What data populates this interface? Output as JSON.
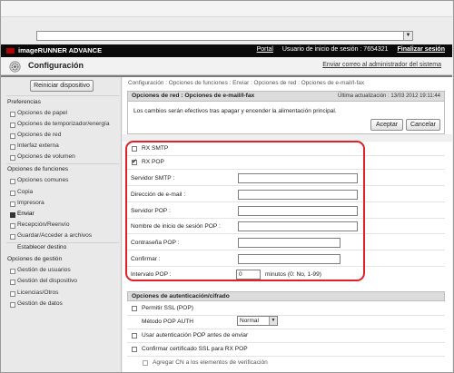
{
  "brand": {
    "product": "imageRUNNER ADVANCE",
    "portal_link": "Portal",
    "user_info": "Usuario de inicio de sesión : 7654321",
    "logout": "Finalizar sesión"
  },
  "header": {
    "title": "Configuración",
    "admin_link": "Enviar correo al administrador del sistema"
  },
  "sidebar": {
    "restart_button": "Reiniciar dispositivo",
    "items": [
      {
        "label": "Preferencias",
        "kind": "head"
      },
      {
        "label": "Opciones de papel",
        "kind": "sub"
      },
      {
        "label": "Opciones de temporizador/energía",
        "kind": "sub"
      },
      {
        "label": "Opciones de red",
        "kind": "sub"
      },
      {
        "label": "Interfaz externa",
        "kind": "sub"
      },
      {
        "label": "Opciones de volumen",
        "kind": "sub"
      },
      {
        "label": "Opciones de funciones",
        "kind": "head"
      },
      {
        "label": "Opciones comunes",
        "kind": "sub"
      },
      {
        "label": "Copia",
        "kind": "sub"
      },
      {
        "label": "Impresora",
        "kind": "sub"
      },
      {
        "label": "Enviar",
        "kind": "sub",
        "active": true
      },
      {
        "label": "Recepción/Reenvío",
        "kind": "sub"
      },
      {
        "label": "Guardar/Acceder a archivos",
        "kind": "sub"
      },
      {
        "label": "Establecer destino",
        "kind": "head"
      },
      {
        "label": "Opciones de gestión",
        "kind": "head"
      },
      {
        "label": "Gestión de usuarios",
        "kind": "sub"
      },
      {
        "label": "Gestión del dispositivo",
        "kind": "sub"
      },
      {
        "label": "Licencias/Otros",
        "kind": "sub"
      },
      {
        "label": "Gestión de datos",
        "kind": "sub"
      }
    ]
  },
  "main": {
    "breadcrumb": "Configuración : Opciones de funciones : Enviar : Opciones de red : Opciones de e-mail/I-fax",
    "panel_title": "Opciones de red : Opciones de e-mail/I-fax",
    "last_update": "Última actualización : 13/03 2012 19:11:44",
    "notice": "Los cambios serán efectivos tras apagar y encender la alimentación principal.",
    "ok_button": "Aceptar",
    "cancel_button": "Cancelar",
    "form": {
      "rx_smtp": {
        "label": "RX SMTP",
        "checked": false
      },
      "rx_pop": {
        "label": "RX POP",
        "checked": true
      },
      "smtp_server": {
        "label": "Servidor SMTP :",
        "value": ""
      },
      "email_address": {
        "label": "Dirección de e-mail :",
        "value": ""
      },
      "pop_server": {
        "label": "Servidor POP :",
        "value": ""
      },
      "pop_login": {
        "label": "Nombre de inicio de sesión POP :",
        "value": ""
      },
      "pop_password": {
        "label": "Contraseña POP :",
        "value": ""
      },
      "confirm": {
        "label": "Confirmar :",
        "value": ""
      },
      "pop_interval": {
        "label": "Intervalo POP :",
        "value": "0",
        "unit": "minutos (0: No, 1-99)"
      }
    },
    "auth_section": {
      "title": "Opciones de autenticación/cifrado",
      "allow_ssl": {
        "label": "Permitir SSL (POP)",
        "checked": false
      },
      "pop_auth_method": {
        "label": "Método POP AUTH",
        "value": "Normal"
      },
      "use_pop_before_send": {
        "label": "Usar autenticación POP antes de enviar",
        "checked": false
      },
      "confirm_ssl_cert": {
        "label": "Confirmar certificado SSL para RX POP",
        "checked": false
      },
      "add_cn": {
        "label": "Agregar CN a los elementos de verificación",
        "checked": false
      }
    }
  }
}
